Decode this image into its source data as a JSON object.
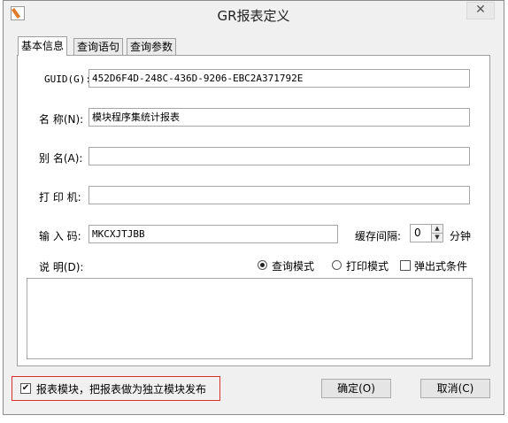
{
  "window": {
    "title": "GR报表定义",
    "close_glyph": "✕",
    "icon_name": "report-edit-icon"
  },
  "tabs": [
    {
      "label": "基本信息",
      "active": true
    },
    {
      "label": "查询语句",
      "active": false
    },
    {
      "label": "查询参数",
      "active": false
    }
  ],
  "form": {
    "guid_label": "GUID(G):",
    "guid_value": "452D6F4D-248C-436D-9206-EBC2A371792E",
    "name_label": "名 称(N):",
    "name_value": "模块程序集统计报表",
    "alias_label": "别 名(A):",
    "alias_value": "",
    "printer_label": "打 印 机:",
    "printer_value": "",
    "code_label": "输 入 码:",
    "code_value": "MKCXJTJBB",
    "cache_label": "缓存间隔:",
    "cache_value": "0",
    "cache_unit": "分钟",
    "desc_label": "说  明(D):",
    "desc_value": "",
    "mode_query_label": "查询模式",
    "mode_query_selected": true,
    "mode_print_label": "打印模式",
    "mode_print_selected": false,
    "popup_condition_label": "弹出式条件",
    "popup_condition_checked": false
  },
  "footer": {
    "report_module_label": "报表模块，把报表做为独立模块发布",
    "report_module_checked": true,
    "ok_label": "确定(O)",
    "cancel_label": "取消(C)",
    "highlight_color": "#d9302c"
  }
}
